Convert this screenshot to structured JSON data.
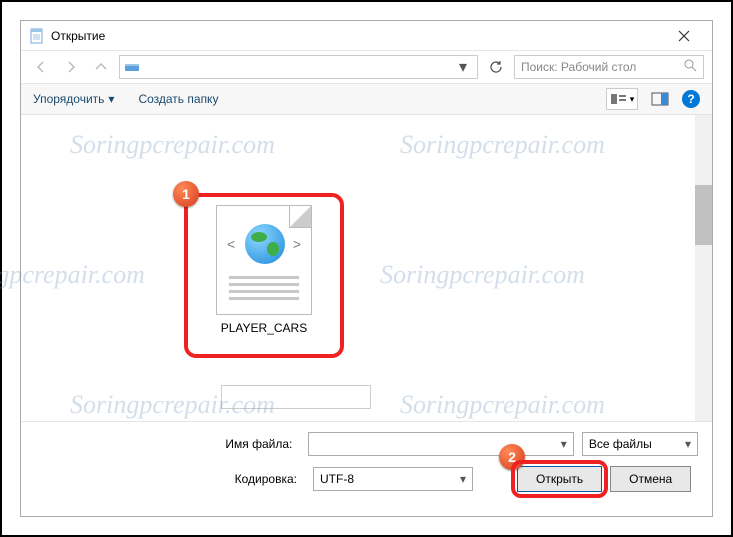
{
  "window": {
    "title": "Открытие"
  },
  "nav": {
    "search_placeholder": "Поиск: Рабочий стол"
  },
  "toolbar": {
    "organize": "Упорядочить",
    "new_folder": "Создать папку",
    "help": "?"
  },
  "file": {
    "name": "PLAYER_CARS"
  },
  "markers": {
    "one": "1",
    "two": "2"
  },
  "labels": {
    "filename": "Имя файла:",
    "encoding": "Кодировка:"
  },
  "filetype": {
    "selected": "Все файлы"
  },
  "encoding": {
    "selected": "UTF-8"
  },
  "buttons": {
    "open": "Открыть",
    "cancel": "Отмена"
  },
  "watermark": "Soringpcrepair.com"
}
